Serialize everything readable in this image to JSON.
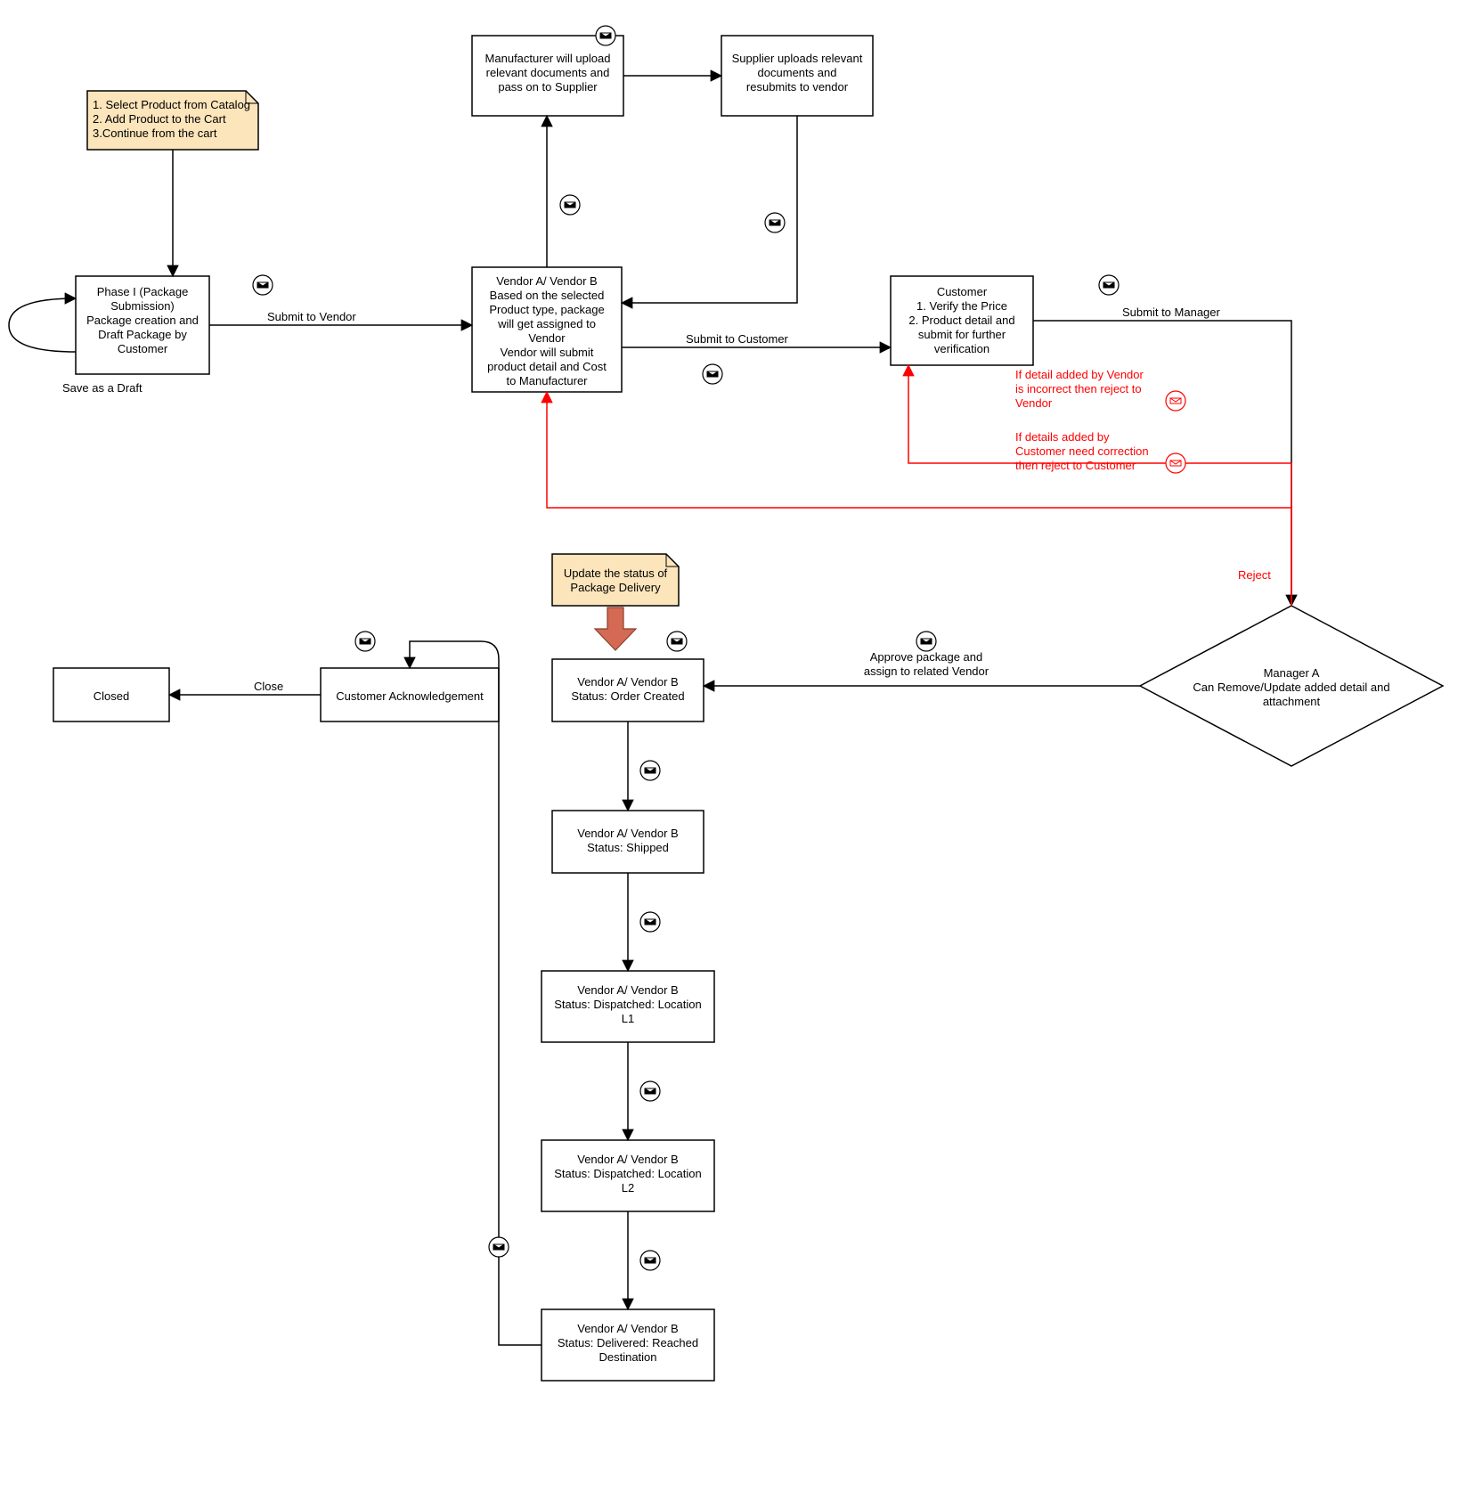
{
  "notes": {
    "catalog": {
      "line1": "1. Select Product from Catalog",
      "line2": "2. Add Product to the Cart",
      "line3": "3.Continue from the cart"
    },
    "update_status": {
      "line1": "Update the status of",
      "line2": "Package Delivery"
    }
  },
  "nodes": {
    "phase1": {
      "l1": "Phase I (Package",
      "l2": "Submission)",
      "l3": "Package creation and",
      "l4": "Draft Package by",
      "l5": "Customer"
    },
    "vendor_assign": {
      "l1": "Vendor A/ Vendor B",
      "l2": "Based on the selected",
      "l3": "Product type, package",
      "l4": "will get assigned to",
      "l5": "Vendor",
      "l6": "Vendor will submit",
      "l7": "product detail and Cost",
      "l8": "to Manufacturer"
    },
    "manufacturer": {
      "l1": "Manufacturer will upload",
      "l2": "relevant documents and",
      "l3": "pass on to Supplier"
    },
    "supplier": {
      "l1": "Supplier uploads relevant",
      "l2": "documents and",
      "l3": "resubmits to vendor"
    },
    "customer": {
      "l1": "Customer",
      "l2": "1. Verify the Price",
      "l3": "2. Product detail and",
      "l4": "submit for further",
      "l5": "verification"
    },
    "manager": {
      "l1": "Manager A",
      "l2": "Can Remove/Update added detail and",
      "l3": "attachment"
    },
    "order_created": {
      "l1": "Vendor A/ Vendor B",
      "l2": "Status: Order Created"
    },
    "shipped": {
      "l1": "Vendor A/ Vendor B",
      "l2": "Status: Shipped"
    },
    "disp_l1": {
      "l1": "Vendor A/ Vendor B",
      "l2": "Status: Dispatched: Location",
      "l3": "L1"
    },
    "disp_l2": {
      "l1": "Vendor A/ Vendor B",
      "l2": "Status: Dispatched: Location",
      "l3": "L2"
    },
    "delivered": {
      "l1": "Vendor A/ Vendor B",
      "l2": "Status: Delivered: Reached",
      "l3": "Destination"
    },
    "cust_ack": "Customer Acknowledgement",
    "closed": "Closed"
  },
  "edges": {
    "save_draft": "Save as a Draft",
    "submit_vendor": "Submit to Vendor",
    "submit_customer": "Submit to Customer",
    "submit_manager": "Submit to Manager",
    "reject": "Reject",
    "reject_vendor": {
      "l1": "If detail added by Vendor",
      "l2": "is incorrect then reject to",
      "l3": "Vendor"
    },
    "reject_customer": {
      "l1": "If details added by",
      "l2": "Customer need correction",
      "l3": "then reject to Customer"
    },
    "approve_assign": {
      "l1": "Approve package and",
      "l2": "assign to related Vendor"
    },
    "close": "Close"
  }
}
